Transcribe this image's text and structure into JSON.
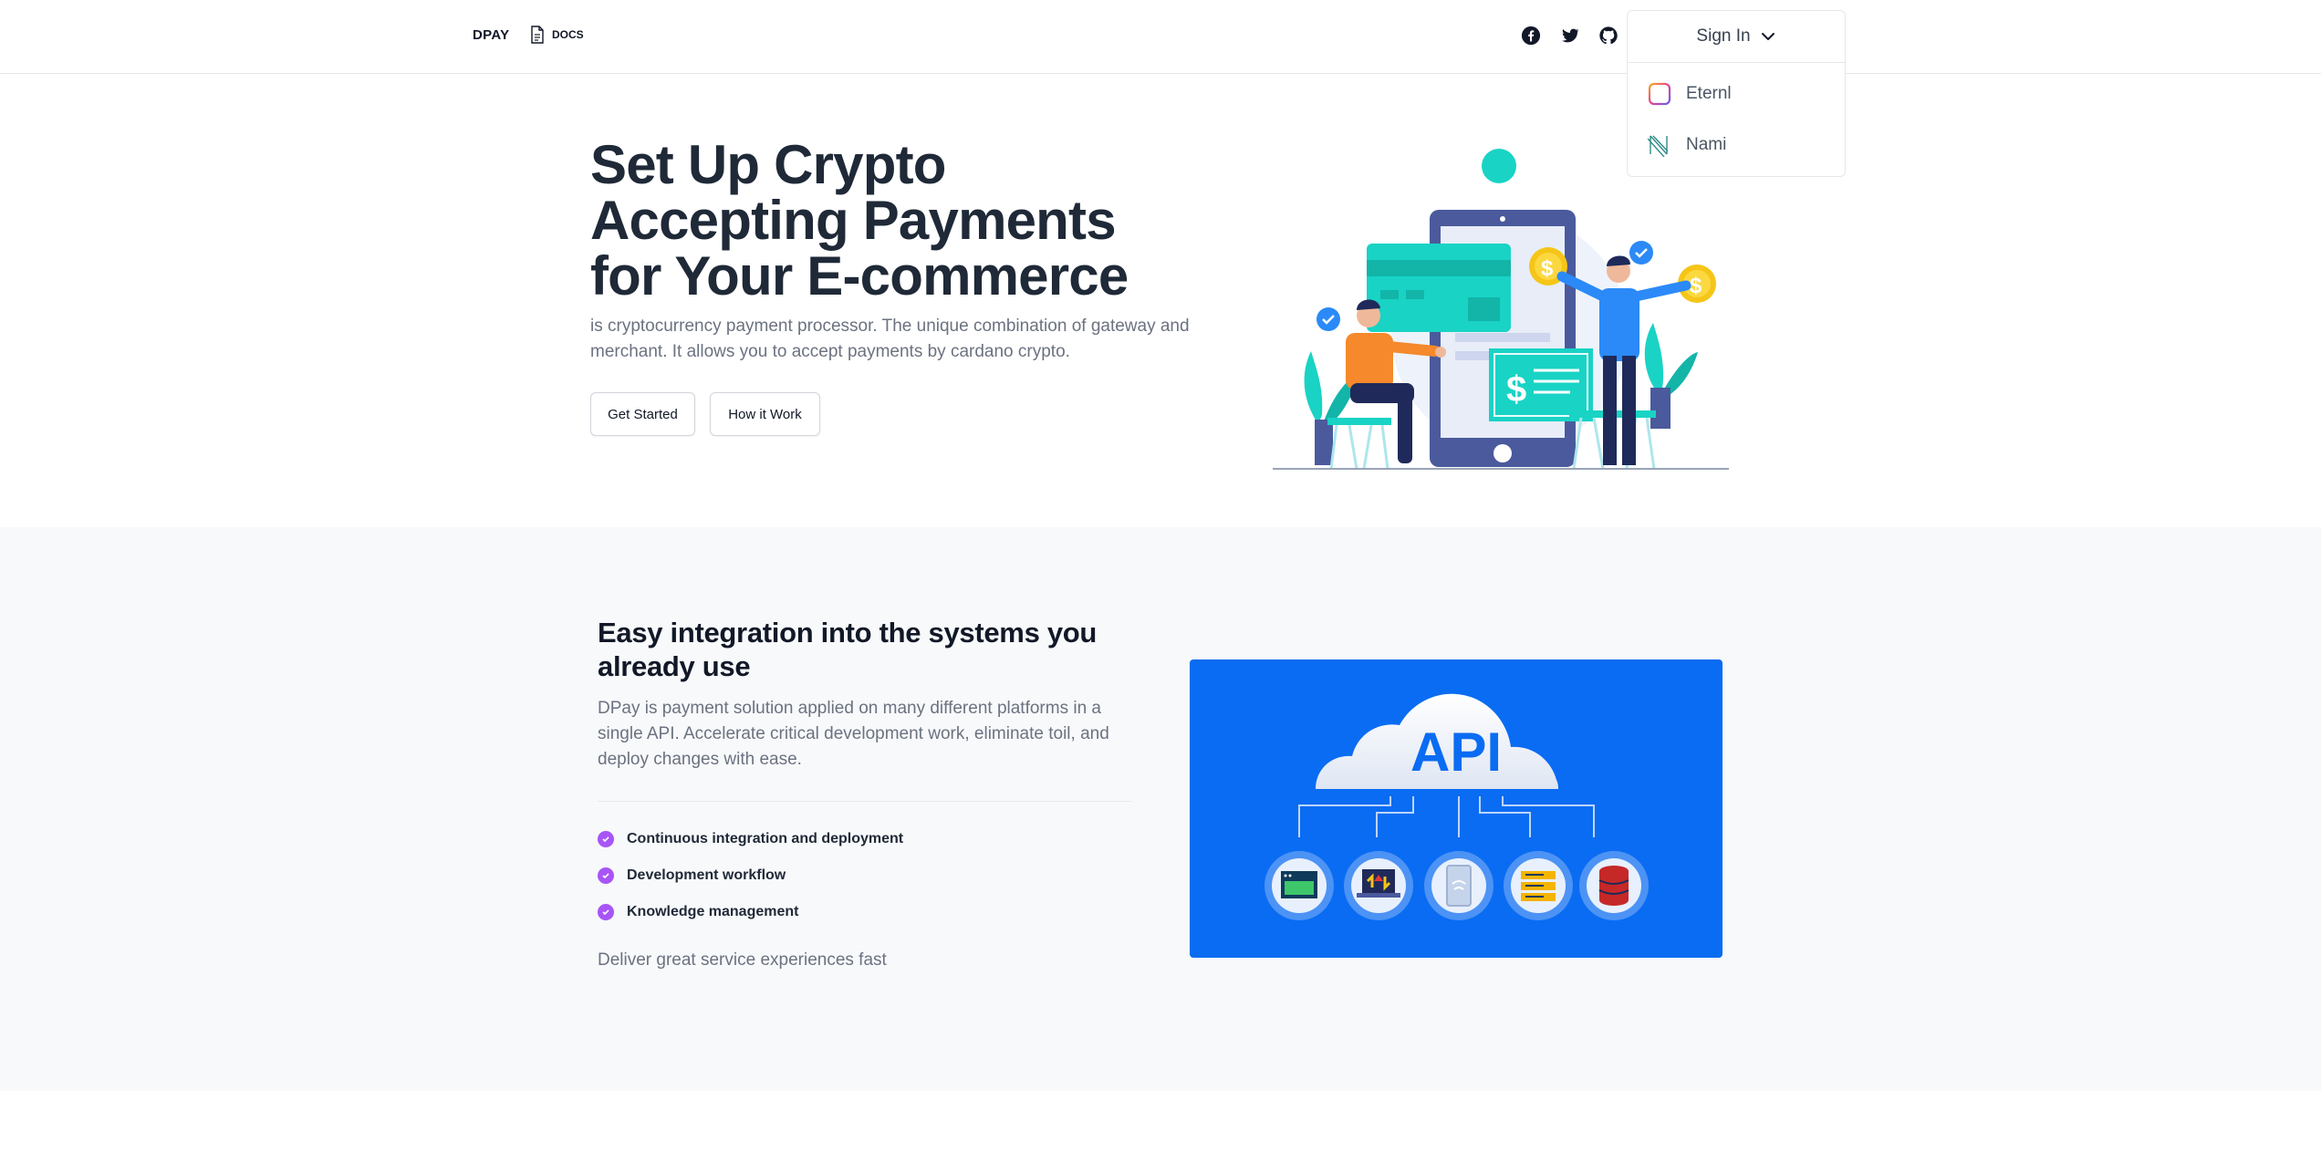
{
  "nav": {
    "brand": "DPAY",
    "docs_label": "DOCS",
    "social": [
      "facebook-icon",
      "twitter-icon",
      "github-icon"
    ],
    "signin_label": "Sign In",
    "wallets": [
      {
        "label": "Eternl",
        "icon": "eternl-icon"
      },
      {
        "label": "Nami",
        "icon": "nami-icon"
      }
    ]
  },
  "hero": {
    "title_lines": [
      "Set Up Crypto",
      "Accepting Payments",
      "for Your E-commerce"
    ],
    "subtitle": "is cryptocurrency payment processor. The unique combination of gateway and merchant. It allows you to accept payments by cardano crypto.",
    "primary_button": "Get Started",
    "secondary_button": "How it Work"
  },
  "integration": {
    "title": "Easy integration into the systems you already use",
    "description": "DPay is payment solution applied on many different platforms in a single API. Accelerate critical development work, eliminate toil, and deploy changes with ease.",
    "features": [
      "Continuous integration and deployment",
      "Development workflow",
      "Knowledge management"
    ],
    "footer": "Deliver great service experiences fast",
    "illustration_label": "API"
  },
  "colors": {
    "accent_purple": "#a855f7",
    "api_blue": "#0a6cf2",
    "teal": "#19d3c5",
    "navy": "#4a5a9c"
  }
}
